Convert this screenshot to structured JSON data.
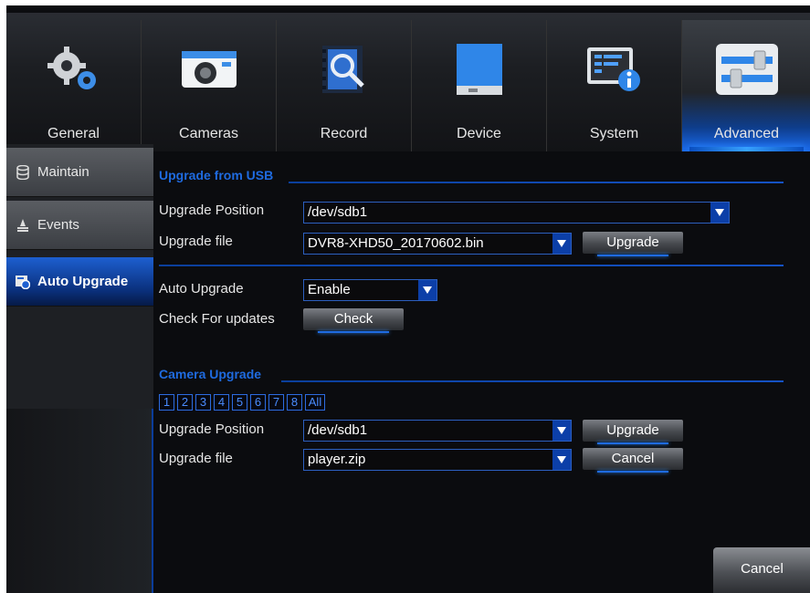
{
  "nav": {
    "tabs": [
      {
        "label": "General",
        "icon": "gears-icon"
      },
      {
        "label": "Cameras",
        "icon": "camera-icon"
      },
      {
        "label": "Record",
        "icon": "record-search-icon"
      },
      {
        "label": "Device",
        "icon": "hard-drive-icon"
      },
      {
        "label": "System",
        "icon": "system-info-icon"
      },
      {
        "label": "Advanced",
        "icon": "sliders-icon"
      }
    ],
    "active_tab": "Advanced"
  },
  "sidebar": {
    "items": [
      {
        "label": "Maintain",
        "icon": "database-icon"
      },
      {
        "label": "Events",
        "icon": "events-icon"
      },
      {
        "label": "Auto Upgrade",
        "icon": "upgrade-icon"
      }
    ],
    "active_item": "Auto Upgrade"
  },
  "usb_section": {
    "title": "Upgrade from USB",
    "position_label": "Upgrade Position",
    "position_value": "/dev/sdb1",
    "file_label": "Upgrade file",
    "file_value": "DVR8-XHD50_20170602.bin",
    "upgrade_button": "Upgrade"
  },
  "auto_section": {
    "auto_label": "Auto Upgrade",
    "auto_value": "Enable",
    "check_label": "Check For updates",
    "check_button": "Check"
  },
  "camera_section": {
    "title": "Camera Upgrade",
    "channels": [
      "1",
      "2",
      "3",
      "4",
      "5",
      "6",
      "7",
      "8",
      "All"
    ],
    "position_label": "Upgrade Position",
    "position_value": "/dev/sdb1",
    "file_label": "Upgrade file",
    "file_value": "player.zip",
    "upgrade_button": "Upgrade",
    "cancel_button": "Cancel"
  },
  "footer": {
    "cancel_button": "Cancel"
  },
  "colors": {
    "accent": "#1f6be0",
    "background": "#0b0c0f"
  }
}
